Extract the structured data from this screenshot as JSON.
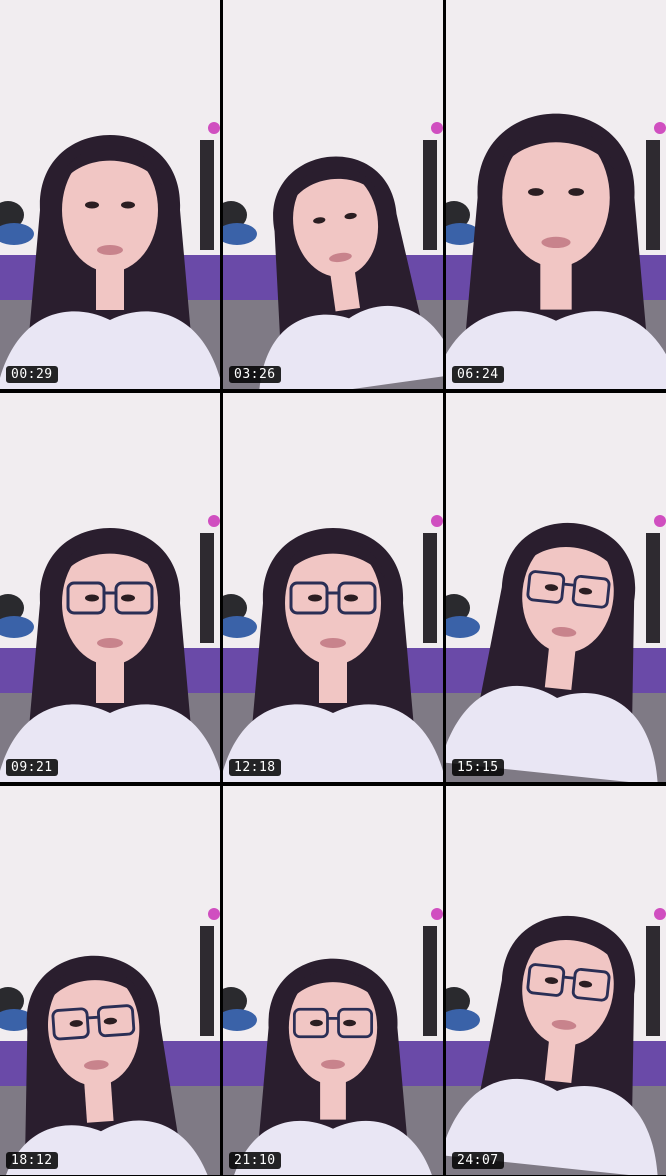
{
  "contact_sheet": {
    "columns": 3,
    "rows": 3,
    "frames": [
      {
        "timestamp": "00:29",
        "glasses": false,
        "head_pose": "center"
      },
      {
        "timestamp": "03:26",
        "glasses": false,
        "head_pose": "tilted"
      },
      {
        "timestamp": "06:24",
        "glasses": false,
        "head_pose": "close"
      },
      {
        "timestamp": "09:21",
        "glasses": true,
        "head_pose": "center"
      },
      {
        "timestamp": "12:18",
        "glasses": true,
        "head_pose": "center"
      },
      {
        "timestamp": "15:15",
        "glasses": true,
        "head_pose": "right"
      },
      {
        "timestamp": "18:12",
        "glasses": true,
        "head_pose": "left"
      },
      {
        "timestamp": "21:10",
        "glasses": true,
        "head_pose": "down"
      },
      {
        "timestamp": "24:07",
        "glasses": true,
        "head_pose": "right"
      }
    ]
  },
  "colors": {
    "wall": "#f1edf0",
    "bed": "#6a4aa8",
    "shirt": "#e9e6f4",
    "hair": "#2a1e2e",
    "skin": "#f1c6c4",
    "glasses": "#2a2e55",
    "timestamp_bg": "#000000",
    "timestamp_text": "#ffffff"
  }
}
